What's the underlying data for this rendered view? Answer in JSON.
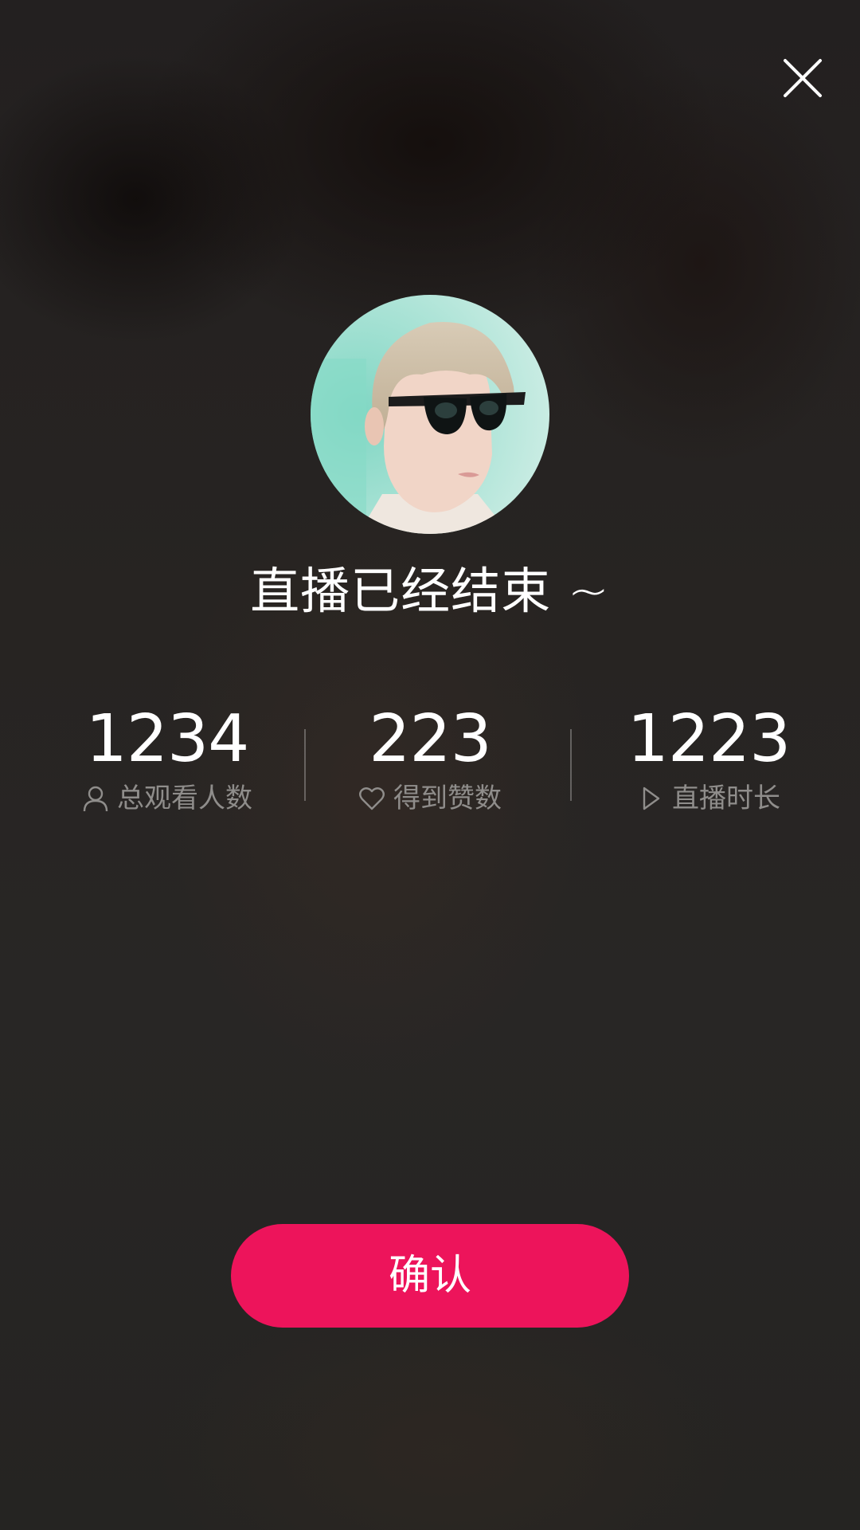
{
  "dialog": {
    "title": "直播已经结束 ~"
  },
  "avatar": {
    "icon": "user-avatar-photo"
  },
  "stats": [
    {
      "value": "1234",
      "label": "总观看人数",
      "icon": "user-icon"
    },
    {
      "value": "223",
      "label": "得到赞数",
      "icon": "heart-icon"
    },
    {
      "value": "1223",
      "label": "直播时长",
      "icon": "play-icon"
    }
  ],
  "actions": {
    "confirm_label": "确认"
  },
  "colors": {
    "accent": "#ed145b",
    "text": "#ffffff",
    "muted_text": "#8f8d8b"
  }
}
